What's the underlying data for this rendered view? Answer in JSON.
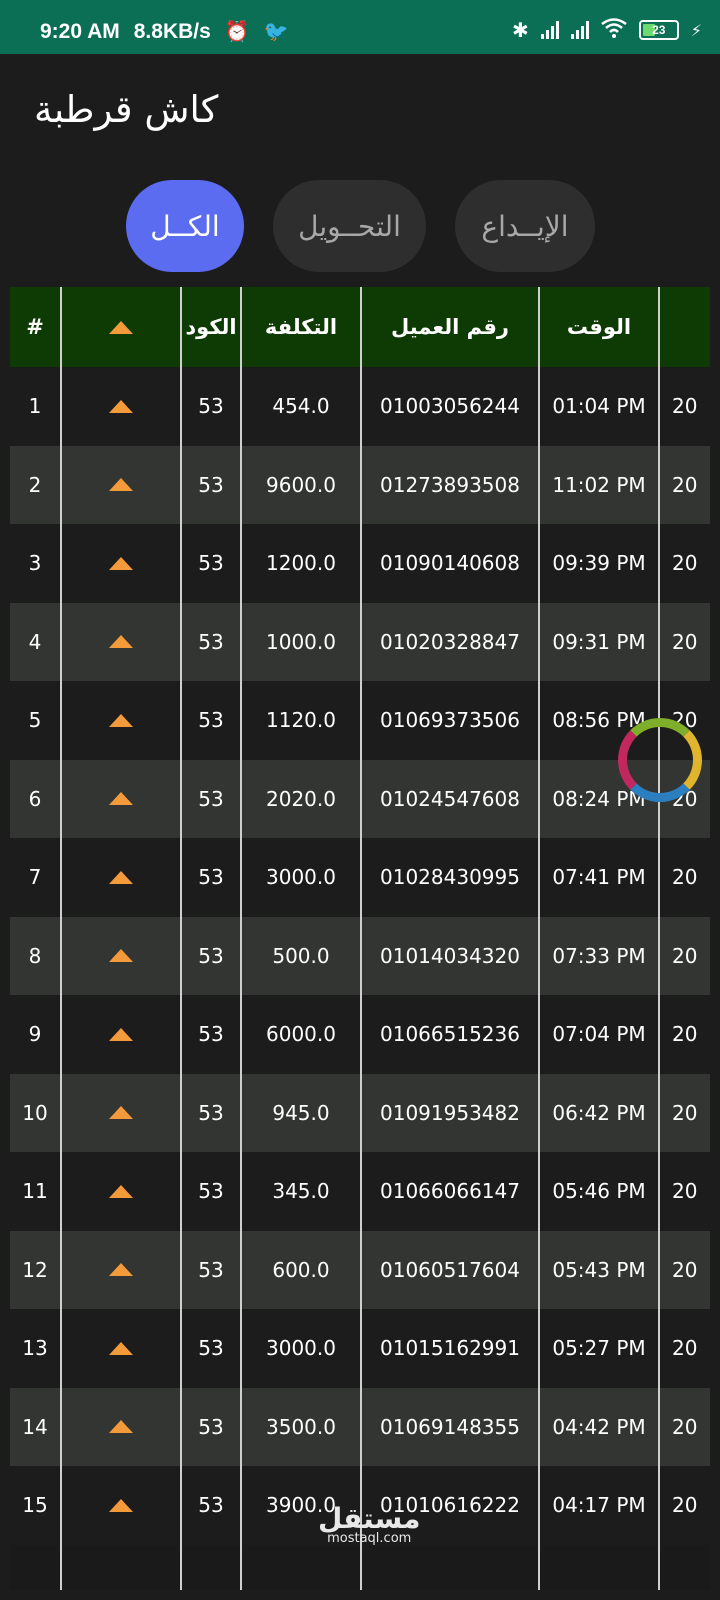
{
  "status_bar": {
    "time": "9:20 AM",
    "speed": "8.8KB/s",
    "alarm_icon": "alarm-icon",
    "twitter_icon": "twitter-icon",
    "battery": "23",
    "colors": {
      "background": "#0b6f55"
    }
  },
  "app": {
    "title": "كاش قرطبة"
  },
  "tabs": [
    {
      "label": "الكــل",
      "active": true
    },
    {
      "label": "التحــويل",
      "active": false
    },
    {
      "label": "الإيــداع",
      "active": false
    }
  ],
  "table": {
    "headers": {
      "index": "#",
      "arrow_icon": "arrow-up-icon",
      "code": "الكود",
      "cost": "التكلفة",
      "client": "رقم العميل",
      "time": "الوقت"
    },
    "rows": [
      {
        "n": "1",
        "code": "53",
        "cost": "454.0",
        "client": "01003056244",
        "time": "01:04 PM",
        "date": "20"
      },
      {
        "n": "2",
        "code": "53",
        "cost": "9600.0",
        "client": "01273893508",
        "time": "11:02 PM",
        "date": "20"
      },
      {
        "n": "3",
        "code": "53",
        "cost": "1200.0",
        "client": "01090140608",
        "time": "09:39 PM",
        "date": "20"
      },
      {
        "n": "4",
        "code": "53",
        "cost": "1000.0",
        "client": "01020328847",
        "time": "09:31 PM",
        "date": "20"
      },
      {
        "n": "5",
        "code": "53",
        "cost": "1120.0",
        "client": "01069373506",
        "time": "08:56 PM",
        "date": "20"
      },
      {
        "n": "6",
        "code": "53",
        "cost": "2020.0",
        "client": "01024547608",
        "time": "08:24 PM",
        "date": "20"
      },
      {
        "n": "7",
        "code": "53",
        "cost": "3000.0",
        "client": "01028430995",
        "time": "07:41 PM",
        "date": "20"
      },
      {
        "n": "8",
        "code": "53",
        "cost": "500.0",
        "client": "01014034320",
        "time": "07:33 PM",
        "date": "20"
      },
      {
        "n": "9",
        "code": "53",
        "cost": "6000.0",
        "client": "01066515236",
        "time": "07:04 PM",
        "date": "20"
      },
      {
        "n": "10",
        "code": "53",
        "cost": "945.0",
        "client": "01091953482",
        "time": "06:42 PM",
        "date": "20"
      },
      {
        "n": "11",
        "code": "53",
        "cost": "345.0",
        "client": "01066066147",
        "time": "05:46 PM",
        "date": "20"
      },
      {
        "n": "12",
        "code": "53",
        "cost": "600.0",
        "client": "01060517604",
        "time": "05:43 PM",
        "date": "20"
      },
      {
        "n": "13",
        "code": "53",
        "cost": "3000.0",
        "client": "01015162991",
        "time": "05:27 PM",
        "date": "20"
      },
      {
        "n": "14",
        "code": "53",
        "cost": "3500.0",
        "client": "01069148355",
        "time": "04:42 PM",
        "date": "20"
      },
      {
        "n": "15",
        "code": "53",
        "cost": "3900.0",
        "client": "01010616222",
        "time": "04:17 PM",
        "date": "20"
      }
    ],
    "colors": {
      "header": "#0e3a03",
      "row_alt": "#333533",
      "arrow": "#f39a3a"
    }
  },
  "watermark": {
    "arabic": "مستقل",
    "latin": "mostaql.com"
  },
  "accent": "#5b6cf0"
}
